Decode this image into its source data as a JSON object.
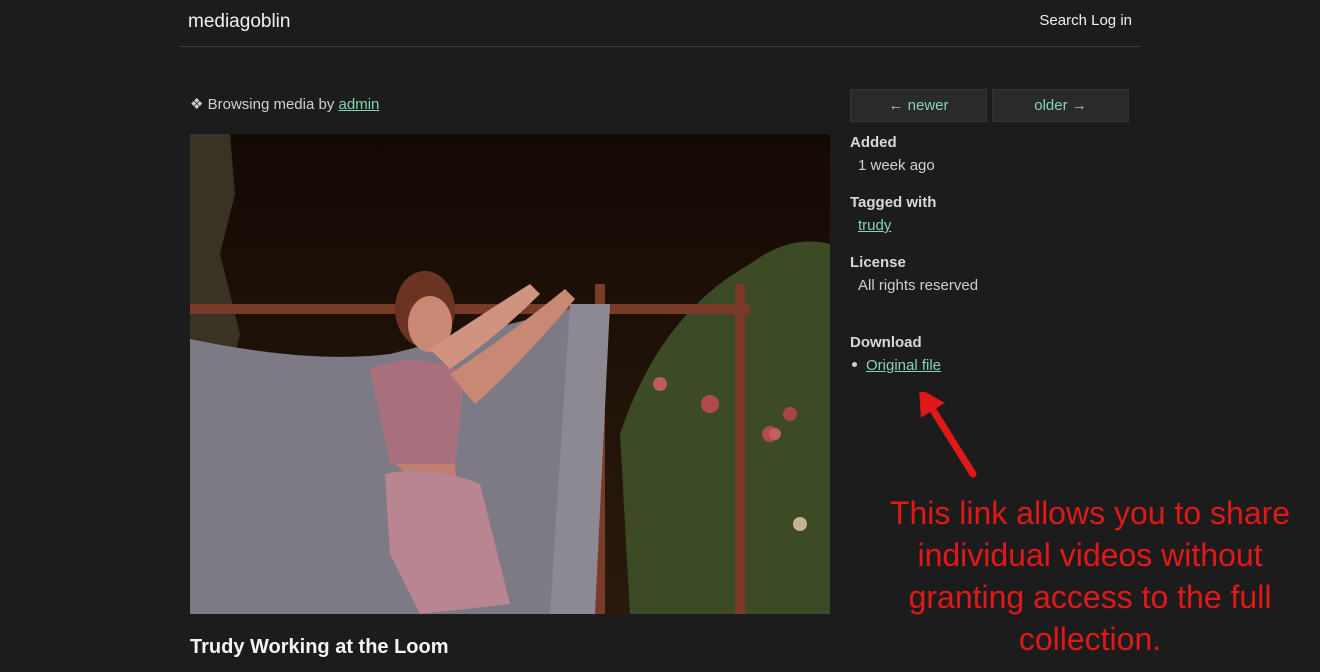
{
  "header": {
    "logo": "mediagoblin",
    "search_label": "Search",
    "login_label": "Log in"
  },
  "browsing": {
    "prefix": "❖ Browsing media by ",
    "user": "admin"
  },
  "nav": {
    "newer": "← newer",
    "older": "older →"
  },
  "media": {
    "title": "Trudy Working at the Loom"
  },
  "sidebar": {
    "added_label": "Added",
    "added_value": "1 week ago",
    "tagged_label": "Tagged with",
    "tag": "trudy",
    "license_label": "License",
    "license_value": "All rights reserved",
    "download_label": "Download",
    "download_link": "Original file"
  },
  "annotation": {
    "line1": "This link allows you to share",
    "line2": "individual videos without",
    "line3": "granting access to the full",
    "line4": "collection."
  },
  "colors": {
    "background": "#1c1c1c",
    "link": "#86d4b1",
    "annotation": "#e01818"
  }
}
